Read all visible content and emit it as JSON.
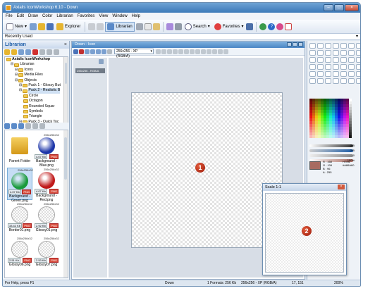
{
  "window": {
    "title": "Axialis IconWorkshop 6.10 - Down"
  },
  "menu": [
    "File",
    "Edit",
    "Draw",
    "Color",
    "Librarian",
    "Favorites",
    "View",
    "Window",
    "Help"
  ],
  "toolbar": {
    "new_label": "New",
    "explorer_label": "Explorer",
    "librarian_label": "Librarian",
    "search_label": "Search",
    "favorites_label": "Favorites"
  },
  "recent": {
    "label": "Recently Used"
  },
  "librarian": {
    "title": "Librarian",
    "tree": [
      {
        "label": "Axialis IconWorkshop",
        "level": 0,
        "bold": true
      },
      {
        "label": "Librarian",
        "level": 1
      },
      {
        "label": "Icons",
        "level": 2
      },
      {
        "label": "Media Files",
        "level": 2
      },
      {
        "label": "Objects",
        "level": 2
      },
      {
        "label": "Pack 1 - Glossy But",
        "level": 3
      },
      {
        "label": "Pack 2 - Realistic B",
        "level": 3
      },
      {
        "label": "Circle",
        "level": 4
      },
      {
        "label": "Octagon",
        "level": 4
      },
      {
        "label": "Rounded Squar",
        "level": 4
      },
      {
        "label": "Symbols",
        "level": 4
      },
      {
        "label": "Triangle",
        "level": 4
      },
      {
        "label": "Pack 3 - Quick Toc",
        "level": 3
      }
    ],
    "tiles": [
      {
        "label": "Parent Folder",
        "size": "",
        "fmt": "",
        "color": "#e8a820",
        "kind": "folder"
      },
      {
        "label": "Background - Blue.png",
        "size": "4.07 Kb",
        "fmt": "256x256x32",
        "color": "#1c35a8"
      },
      {
        "label": "Background - Green.png",
        "size": "4.07 Kb",
        "fmt": "256x256x32",
        "color": "#1a9a3c"
      },
      {
        "label": "Background - Red.png",
        "size": "4.07 Kb",
        "fmt": "256x256x32",
        "color": "#c01a1a"
      },
      {
        "label": "Border01.png",
        "size": "33.42 Kb",
        "fmt": "256x256x32",
        "color": "#dddddd"
      },
      {
        "label": "Glossy01.png",
        "size": "2.92 Kb",
        "fmt": "256x256x32",
        "color": "#eeeeee"
      },
      {
        "label": "Glossy06.png",
        "size": "2.51 Kb",
        "fmt": "256x256x32",
        "color": "#eeeeee"
      },
      {
        "label": "Glossy07.png",
        "size": "2.53 Kb",
        "fmt": "256x256x32",
        "color": "#eeeeee"
      }
    ],
    "png_badge": "PNG"
  },
  "document": {
    "title": "Down - Icon",
    "format_select": "256x256 - XP (RGB/A)",
    "format_item": "256x256 - RGB/A",
    "callout": "1"
  },
  "scale_window": {
    "title": "Scale 1:1",
    "callout": "2"
  },
  "color_panel": {
    "r": "R : 168",
    "g": "G : 106",
    "b": "B : 96",
    "a": "A : 255",
    "hex_label": "HTML",
    "hex_value": "#A86A60",
    "slider_values": [
      "255",
      "255",
      "0",
      "100%"
    ]
  },
  "status": {
    "help": "For Help, press F1",
    "name": "Down",
    "formats": "1 Formats: 256 Kb",
    "format": "256x256 - XP (RGB/A)",
    "coords": "17, 151",
    "zoom": "200%"
  }
}
